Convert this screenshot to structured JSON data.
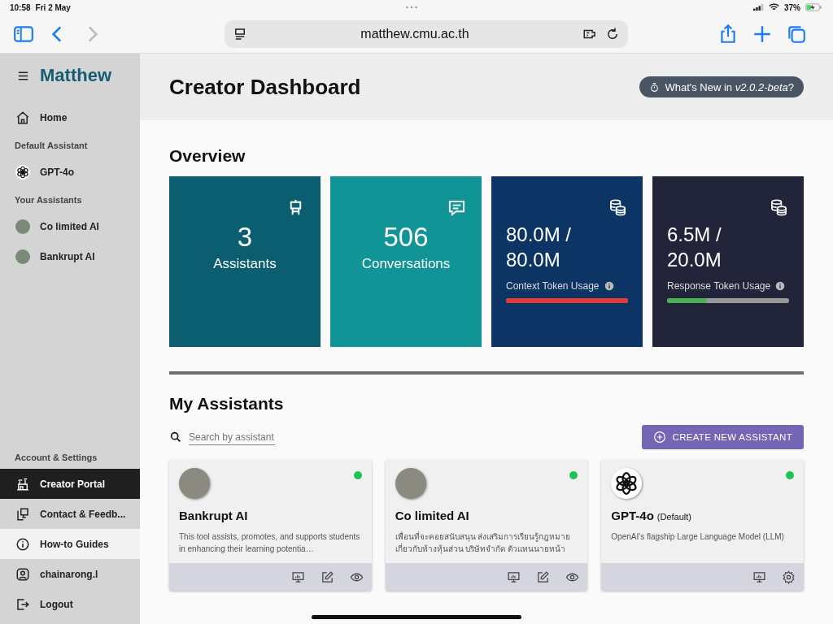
{
  "status_bar": {
    "time": "10:58",
    "date": "Fri 2 May",
    "battery": "37%",
    "charging": true
  },
  "browser": {
    "url": "matthew.cmu.ac.th"
  },
  "sidebar": {
    "brand": "Matthew",
    "sections": [
      {
        "items": [
          {
            "label": "Home",
            "selected": false,
            "hovered": false
          }
        ]
      },
      {
        "heading": "Default Assistant",
        "items": [
          {
            "label": "GPT-4o",
            "selected": false,
            "hovered": false
          }
        ]
      },
      {
        "heading": "Your Assistants",
        "items": [
          {
            "label": "Co limited AI",
            "selected": false,
            "hovered": false
          },
          {
            "label": "Bankrupt AI",
            "selected": false,
            "hovered": false
          }
        ]
      }
    ],
    "account": {
      "heading": "Account & Settings",
      "items": [
        {
          "label": "Creator Portal",
          "selected": true,
          "hovered": false
        },
        {
          "label": "Contact & Feedb...",
          "selected": false,
          "hovered": false
        },
        {
          "label": "How-to Guides",
          "selected": false,
          "hovered": true
        },
        {
          "label": "chainarong.l",
          "selected": false,
          "hovered": false
        },
        {
          "label": "Logout",
          "selected": false,
          "hovered": false
        }
      ]
    }
  },
  "header": {
    "title": "Creator Dashboard",
    "whats_new": "What's New in *v2.0.2-beta*?"
  },
  "overview": {
    "title": "Overview",
    "cards": [
      {
        "kind": "count",
        "value": "3",
        "label": "Assistants",
        "color": "#0b5e70"
      },
      {
        "kind": "count",
        "value": "506",
        "label": "Conversations",
        "color": "#109496"
      },
      {
        "kind": "usage",
        "value": "80.0M / 80.0M",
        "label": "Context Token Usage",
        "color": "#0c3566",
        "level": 1.0,
        "over_limit": true
      },
      {
        "kind": "usage",
        "value": "6.5M / 20.0M",
        "label": "Response Token Usage",
        "color": "#22253a",
        "level": 0.325,
        "over_limit": false
      }
    ]
  },
  "assistants": {
    "title": "My Assistants",
    "search": {
      "placeholder": "Search by assistant"
    },
    "create_button": "CREATE NEW ASSISTANT",
    "cards": [
      {
        "kind": "custom",
        "name": "Bankrupt AI",
        "online": true,
        "description": "This tool assists, promotes, and supports students in enhancing their learning potentia…"
      },
      {
        "kind": "custom",
        "name": "Co limited AI",
        "online": true,
        "description": "เพื่อนที่จะคอยสนับสนุน ส่งเสริมการเรียนรู้กฎหมาย เกี่ยวกับห้างหุ้นส่วน บริษัทจำกัด ตัวแทนนายหน้า"
      },
      {
        "kind": "default",
        "name": "GPT-4o",
        "tag": "(Default)",
        "online": true,
        "description": "OpenAI's flagship Large Language Model (LLM)"
      }
    ]
  }
}
